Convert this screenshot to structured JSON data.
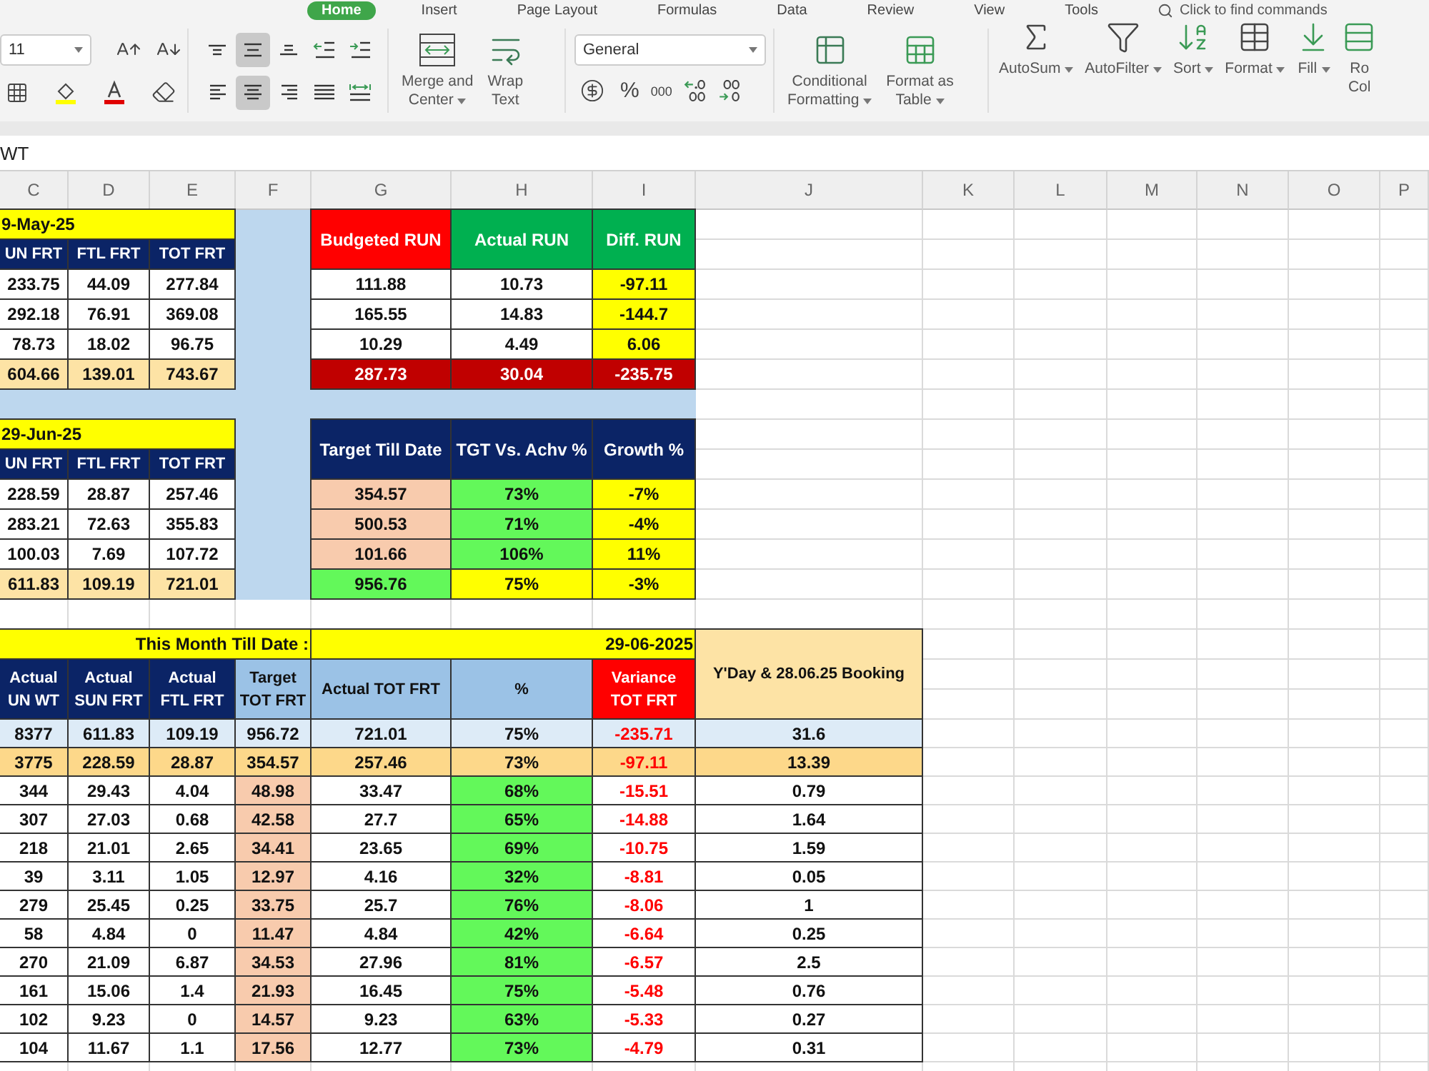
{
  "ribbon_tabs": [
    {
      "label": "Home",
      "selected": true
    },
    {
      "label": "Insert",
      "selected": false
    },
    {
      "label": "Page Layout",
      "selected": false
    },
    {
      "label": "Formulas",
      "selected": false
    },
    {
      "label": "Data",
      "selected": false
    },
    {
      "label": "Review",
      "selected": false
    },
    {
      "label": "View",
      "selected": false
    },
    {
      "label": "Tools",
      "selected": false
    }
  ],
  "search": {
    "placeholder": "Click to find commands"
  },
  "font_group": {
    "font_size": "11",
    "tools": [
      {
        "kind": "grow"
      },
      {
        "kind": "shrink"
      },
      {
        "kind": "border"
      },
      {
        "kind": "fill"
      },
      {
        "kind": "color"
      },
      {
        "kind": "clear"
      }
    ]
  },
  "alignment": [
    {
      "kind": "top",
      "selected": false
    },
    {
      "kind": "middle",
      "selected": true
    },
    {
      "kind": "bottom",
      "selected": false
    },
    {
      "kind": "outdent",
      "selected": false
    },
    {
      "kind": "indent",
      "selected": false
    },
    {
      "kind": "left",
      "selected": false
    },
    {
      "kind": "center",
      "selected": true
    },
    {
      "kind": "right",
      "selected": false
    },
    {
      "kind": "justify",
      "selected": false
    },
    {
      "kind": "distributed",
      "selected": false
    }
  ],
  "alignment_commands": [
    {
      "kind": "merge",
      "label": "Merge and\nCenter",
      "menu": true
    },
    {
      "kind": "wrap",
      "label": "Wrap\nText",
      "menu": false
    }
  ],
  "number_group": {
    "format": "General",
    "percent": "%",
    "comma": "000"
  },
  "style_commands": [
    {
      "kind": "conditional",
      "label": "Conditional\nFormatting",
      "menu": true
    },
    {
      "kind": "table",
      "label": "Format as\nTable",
      "menu": true
    }
  ],
  "editing_commands": [
    {
      "kind": "autosum",
      "label": "AutoSum",
      "menu": true
    },
    {
      "kind": "autofilter",
      "label": "AutoFilter",
      "menu": true
    },
    {
      "kind": "sort",
      "label": "Sort",
      "menu": true
    },
    {
      "kind": "format",
      "label": "Format",
      "menu": true
    },
    {
      "kind": "fill",
      "label": "Fill",
      "menu": true
    },
    {
      "kind": "rows",
      "label": "Ro\nCol",
      "menu": false
    }
  ],
  "formula_bar": {
    "value": "WT"
  },
  "column_headers": [
    "C",
    "D",
    "E",
    "F",
    "G",
    "H",
    "I",
    "J",
    "K",
    "L",
    "M",
    "N",
    "O",
    "P"
  ],
  "may_block": {
    "date": "9-May-25",
    "headers": [
      "UN FRT",
      "FTL FRT",
      "TOT FRT"
    ],
    "rows": [
      {
        "kind": "item",
        "cells": [
          "233.75",
          "44.09",
          "277.84"
        ]
      },
      {
        "kind": "item",
        "cells": [
          "292.18",
          "76.91",
          "369.08"
        ]
      },
      {
        "kind": "item",
        "cells": [
          "78.73",
          "18.02",
          "96.75"
        ]
      },
      {
        "kind": "total",
        "cells": [
          "604.66",
          "139.01",
          "743.67"
        ]
      }
    ]
  },
  "run_block": {
    "headers": [
      "Budgeted RUN",
      "Actual RUN",
      "Diff. RUN"
    ],
    "rows": [
      {
        "kind": "item",
        "cells": [
          "111.88",
          "10.73",
          "-97.11"
        ]
      },
      {
        "kind": "item",
        "cells": [
          "165.55",
          "14.83",
          "-144.7"
        ]
      },
      {
        "kind": "item",
        "cells": [
          "10.29",
          "4.49",
          "6.06"
        ]
      },
      {
        "kind": "total",
        "cells": [
          "287.73",
          "30.04",
          "-235.75"
        ]
      }
    ]
  },
  "jun_block": {
    "date": "29-Jun-25",
    "headers": [
      "UN FRT",
      "FTL FRT",
      "TOT FRT"
    ],
    "rows": [
      {
        "kind": "item",
        "cells": [
          "228.59",
          "28.87",
          "257.46"
        ]
      },
      {
        "kind": "item",
        "cells": [
          "283.21",
          "72.63",
          "355.83"
        ]
      },
      {
        "kind": "item",
        "cells": [
          "100.03",
          "7.69",
          "107.72"
        ]
      },
      {
        "kind": "total",
        "cells": [
          "611.83",
          "109.19",
          "721.01"
        ]
      }
    ]
  },
  "target_block": {
    "headers": [
      "Target Till Date",
      "TGT Vs. Achv %",
      "Growth  %"
    ],
    "rows": [
      {
        "kind": "item",
        "cells": [
          "354.57",
          "73%",
          "-7%"
        ]
      },
      {
        "kind": "item",
        "cells": [
          "500.53",
          "71%",
          "-4%"
        ]
      },
      {
        "kind": "item",
        "cells": [
          "101.66",
          "106%",
          "11%"
        ]
      },
      {
        "kind": "total",
        "cells": [
          "956.76",
          "75%",
          "-3%"
        ]
      }
    ]
  },
  "month_table": {
    "title": "This Month Till Date :",
    "date": "29-06-2025",
    "headers": [
      "Actual\nUN WT",
      "Actual\nSUN FRT",
      "Actual\nFTL FRT",
      "Target\nTOT FRT",
      "Actual TOT FRT",
      "%",
      "Variance\nTOT FRT",
      "Y'Day & 28.06.25 Booking"
    ],
    "rows": [
      {
        "kind": "total",
        "cells": [
          "8377",
          "611.83",
          "109.19",
          "956.72",
          "721.01",
          "75%",
          "-235.71",
          "31.6"
        ]
      },
      {
        "kind": "subtotal",
        "cells": [
          "3775",
          "228.59",
          "28.87",
          "354.57",
          "257.46",
          "73%",
          "-97.11",
          "13.39"
        ]
      },
      {
        "kind": "item",
        "cells": [
          "344",
          "29.43",
          "4.04",
          "48.98",
          "33.47",
          "68%",
          "-15.51",
          "0.79"
        ]
      },
      {
        "kind": "item",
        "cells": [
          "307",
          "27.03",
          "0.68",
          "42.58",
          "27.7",
          "65%",
          "-14.88",
          "1.64"
        ]
      },
      {
        "kind": "item",
        "cells": [
          "218",
          "21.01",
          "2.65",
          "34.41",
          "23.65",
          "69%",
          "-10.75",
          "1.59"
        ]
      },
      {
        "kind": "item",
        "cells": [
          "39",
          "3.11",
          "1.05",
          "12.97",
          "4.16",
          "32%",
          "-8.81",
          "0.05"
        ]
      },
      {
        "kind": "item",
        "cells": [
          "279",
          "25.45",
          "0.25",
          "33.75",
          "25.7",
          "76%",
          "-8.06",
          "1"
        ]
      },
      {
        "kind": "item",
        "cells": [
          "58",
          "4.84",
          "0",
          "11.47",
          "4.84",
          "42%",
          "-6.64",
          "0.25"
        ]
      },
      {
        "kind": "item",
        "cells": [
          "270",
          "21.09",
          "6.87",
          "34.53",
          "27.96",
          "81%",
          "-6.57",
          "2.5"
        ]
      },
      {
        "kind": "item",
        "cells": [
          "161",
          "15.06",
          "1.4",
          "21.93",
          "16.45",
          "75%",
          "-5.48",
          "0.76"
        ]
      },
      {
        "kind": "item",
        "cells": [
          "102",
          "9.23",
          "0",
          "14.57",
          "9.23",
          "63%",
          "-5.33",
          "0.27"
        ]
      },
      {
        "kind": "item",
        "cells": [
          "104",
          "11.67",
          "1.1",
          "17.56",
          "12.77",
          "73%",
          "-4.79",
          "0.31"
        ]
      }
    ]
  }
}
